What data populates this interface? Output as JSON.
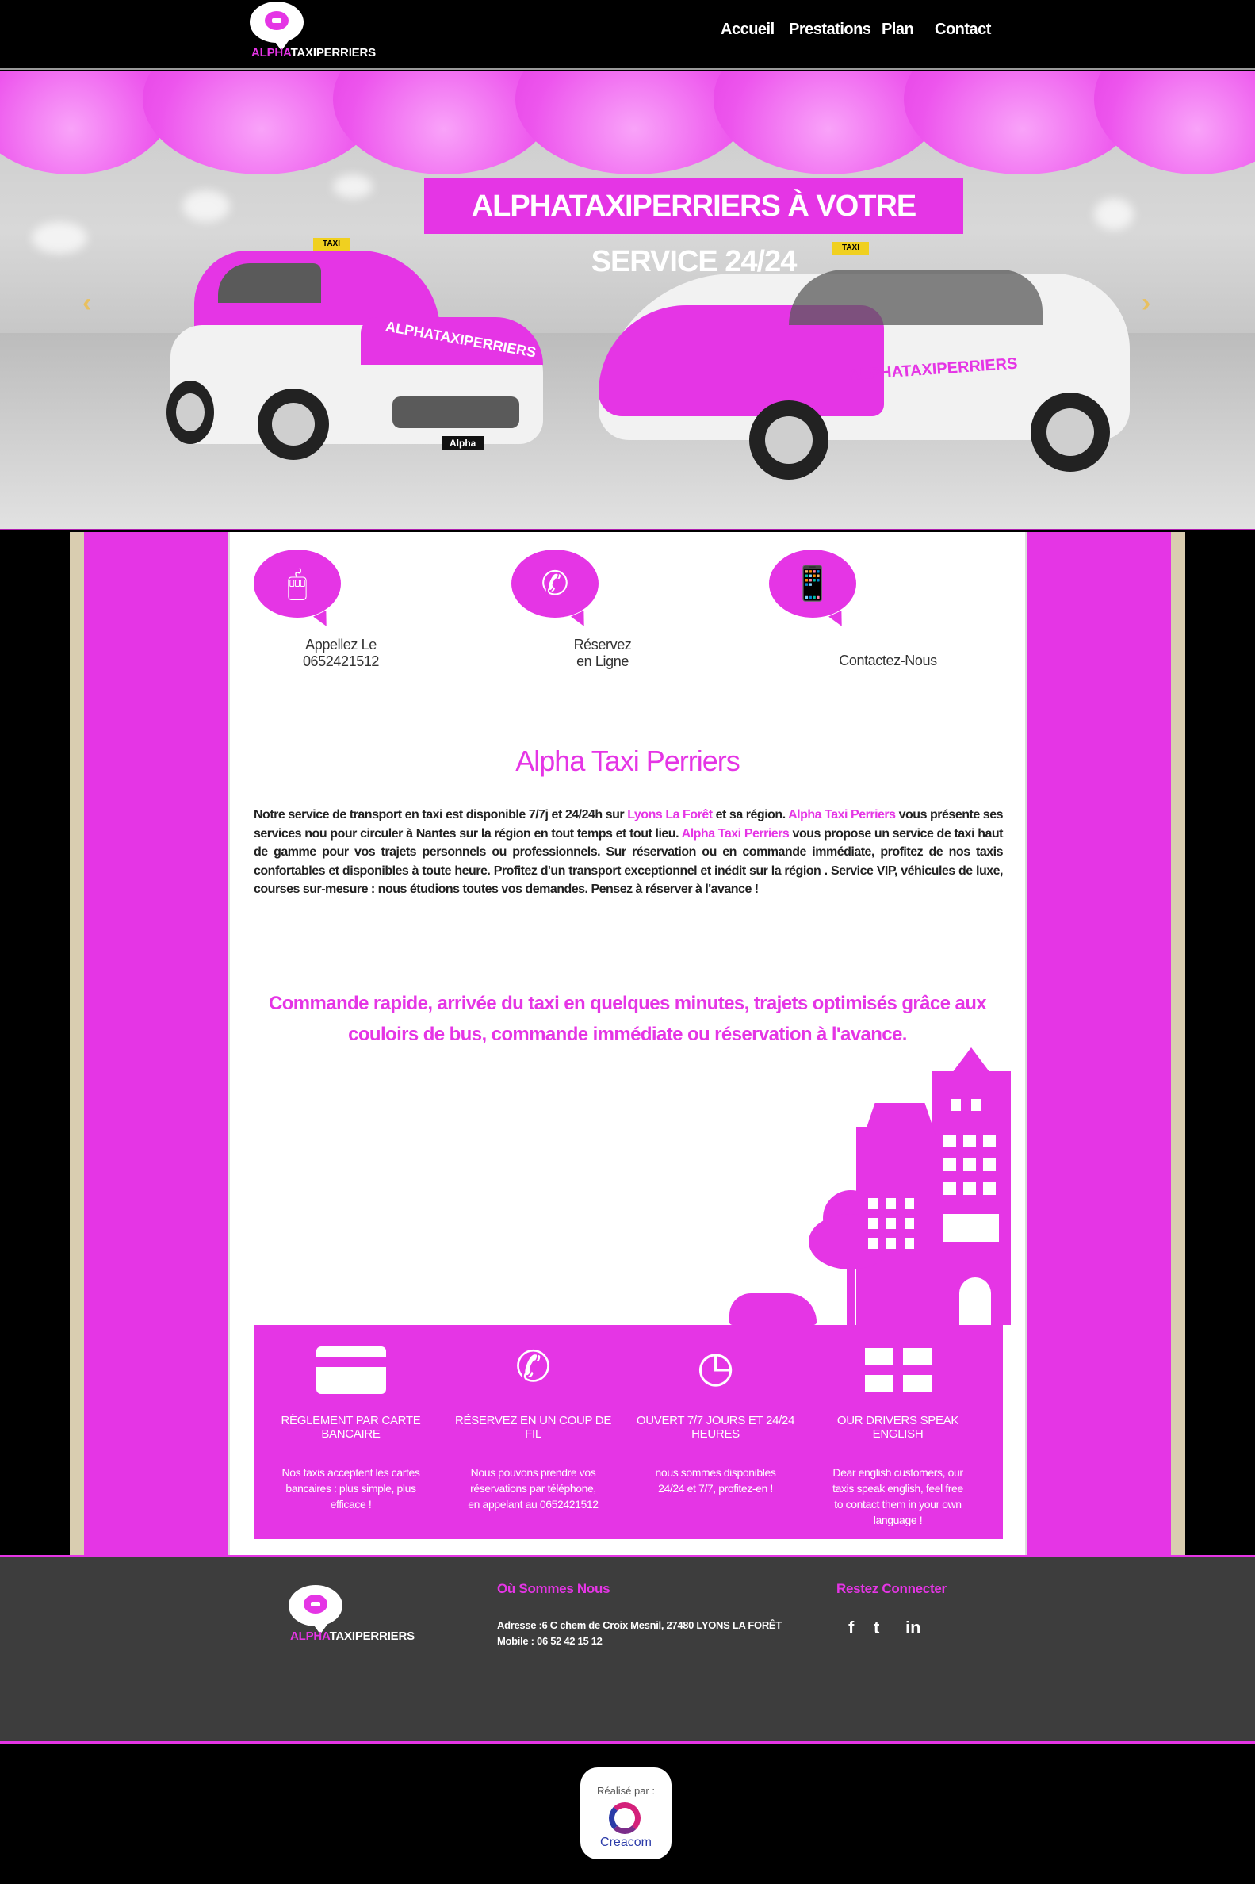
{
  "brand": {
    "prefix": "ALPHA",
    "suffix": "TAXIPERRIERS"
  },
  "nav": {
    "items": [
      "Accueil",
      "Prestations",
      "Plan",
      "Contact"
    ]
  },
  "hero": {
    "title": "ALPHATAXIPERRIERS À VOTRE SERVICE 24/24",
    "prev_arrow": "‹",
    "next_arrow": "›",
    "car1": {
      "sign": "TAXI",
      "door_text": "ALPHATAXIPERRIERS",
      "plate": "Alpha"
    },
    "car2": {
      "sign": "TAXI",
      "door_text": "ALPHATAXIPERRIERS"
    }
  },
  "features": [
    {
      "icon": "mouse-icon",
      "label": "Appellez Le\n0652421512"
    },
    {
      "icon": "phone-icon",
      "label": "Réservez\nen Ligne"
    },
    {
      "icon": "smartphone-icon",
      "label": "Contactez-Nous"
    }
  ],
  "about": {
    "heading": "Alpha Taxi Perriers",
    "p1": "Notre service de transport en taxi est disponible 7/7j et 24/24h sur ",
    "link1": "Lyons La Forêt",
    "p2": " et sa région. ",
    "link2": "Alpha Taxi Perriers",
    "p3": " vous présente ses services nou pour circuler à Nantes sur la région en tout temps et tout lieu. ",
    "link3": "Alpha Taxi Perriers",
    "p4": " vous propose un service de taxi haut de gamme pour vos trajets personnels ou professionnels. Sur réservation ou en commande immédiate, profitez de nos taxis confortables et disponibles à toute heure. Profitez d'un transport exceptionnel et inédit sur la région . Service VIP, véhicules de luxe, courses sur-mesure : nous étudions toutes vos demandes. Pensez à réserver à l'avance !"
  },
  "tagline": "Commande rapide, arrivée du taxi en quelques minutes, trajets optimisés grâce aux couloirs de bus, commande immédiate ou réservation à l'avance.",
  "benefits": [
    {
      "icon": "credit-card-icon",
      "title": "RÈGLEMENT PAR CARTE BANCAIRE",
      "desc": "Nos taxis acceptent les cartes bancaires : plus simple, plus efficace !"
    },
    {
      "icon": "phone-ring-icon",
      "title": "RÉSERVEZ EN UN COUP DE FIL",
      "desc": "Nous pouvons prendre vos réservations par téléphone, en appelant au 0652421512"
    },
    {
      "icon": "clock-icon",
      "title": "OUVERT 7/7 JOURS ET 24/24 HEURES",
      "desc": "nous sommes disponibles 24/24 et 7/7, profitez-en !"
    },
    {
      "icon": "uk-flag-icon",
      "title": "OUR DRIVERS SPEAK ENGLISH",
      "desc": "Dear english customers, our taxis speak english, feel free to contact them in your own language !"
    }
  ],
  "footer": {
    "where_title": "Où Sommes Nous",
    "address": "Adresse :6 C chem de Croix Mesnil, 27480 LYONS LA FORÊT",
    "mobile": "Mobile   :  06 52 42 15 12",
    "social_title": "Restez Connecter",
    "social": [
      "f",
      "t",
      "in"
    ]
  },
  "credit": {
    "label": "Réalisé par :",
    "name": "Creacom"
  },
  "colors": {
    "accent": "#e535e5",
    "footer_bg": "#3d3d3d"
  }
}
